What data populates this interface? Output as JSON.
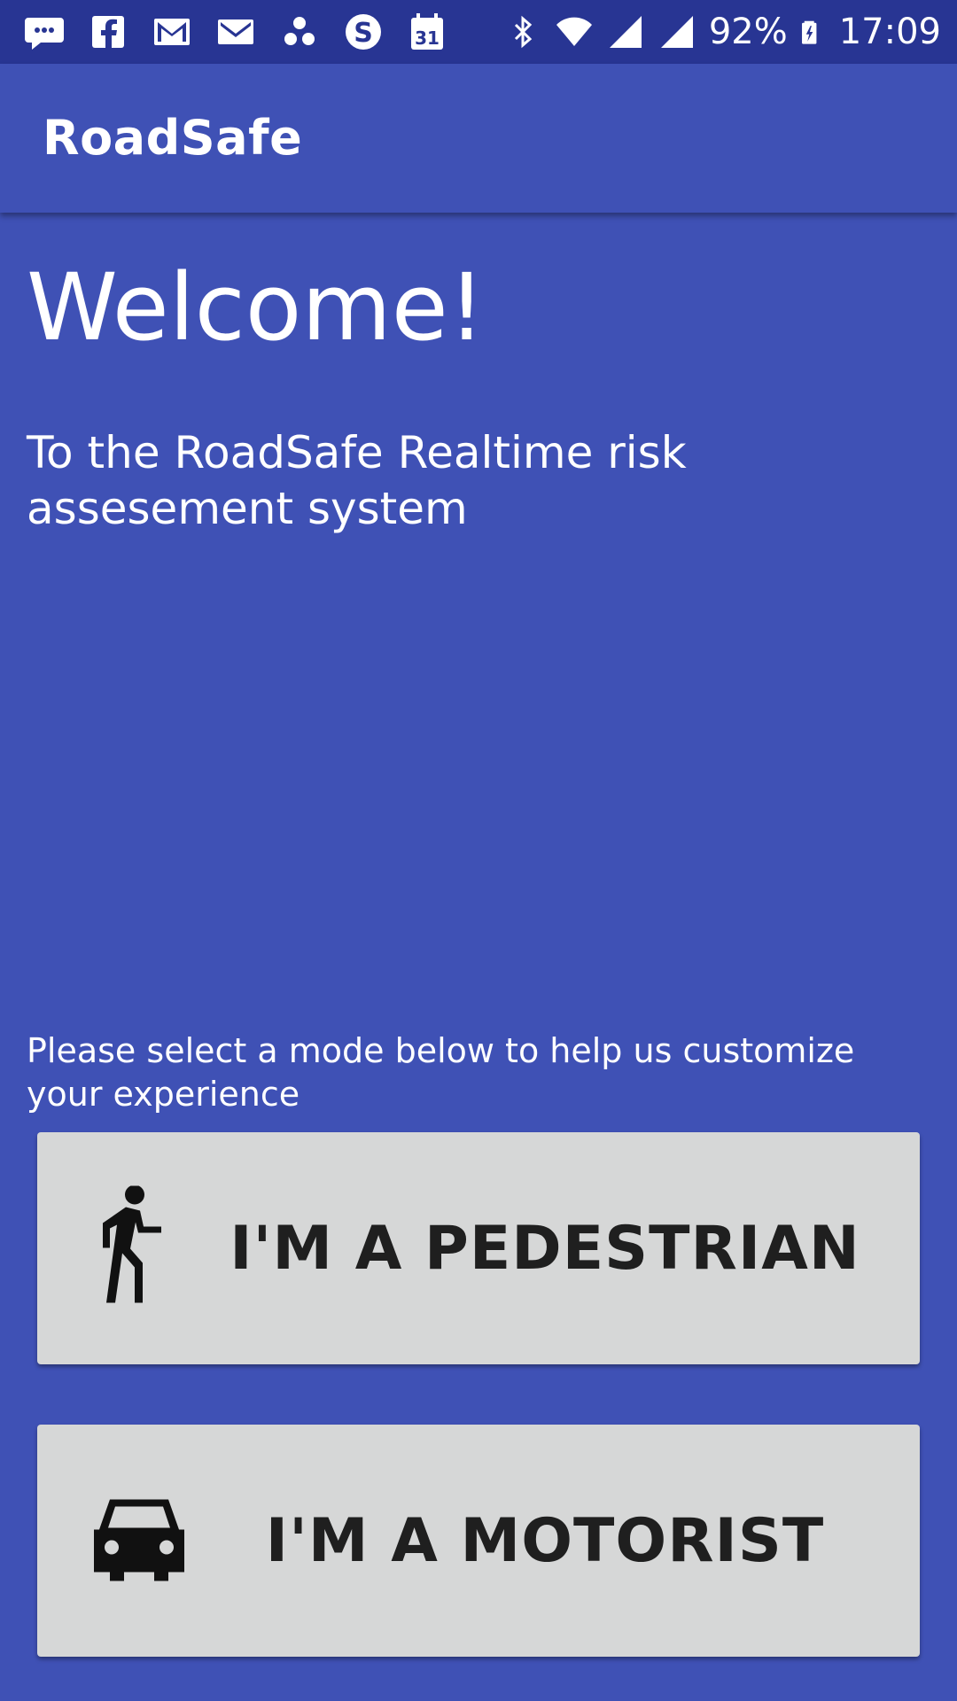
{
  "status_bar": {
    "battery": "92%",
    "time": "17:09",
    "calendar_day": "31",
    "notification_icons": [
      "chat-bubble-icon",
      "facebook-icon",
      "gmail-icon",
      "email-icon",
      "cluster-icon",
      "skype-icon",
      "calendar-icon"
    ],
    "system_icons": [
      "bluetooth-icon",
      "wifi-icon",
      "signal-icon",
      "signal-icon",
      "battery-charging-icon"
    ]
  },
  "app_bar": {
    "title": "RoadSafe"
  },
  "main": {
    "welcome": "Welcome!",
    "subtitle": "To the RoadSafe Realtime risk assesement system",
    "prompt": "Please select a mode below to help us customize your experience",
    "buttons": [
      {
        "label": "I'M A PEDESTRIAN",
        "icon": "pedestrian-icon"
      },
      {
        "label": "I'M A MOTORIST",
        "icon": "car-icon"
      }
    ]
  },
  "colors": {
    "primary": "#3F51B5",
    "status_bar": "#283593",
    "button_bg": "#D6D7D7",
    "button_text": "#1f1f1f",
    "text": "#ffffff"
  }
}
